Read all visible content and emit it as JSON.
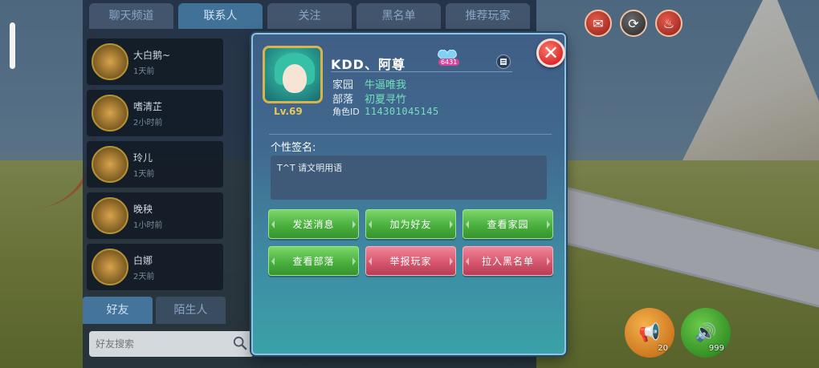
{
  "friends_panel": {
    "tabs": [
      "聊天频道",
      "联系人",
      "关注",
      "黑名单",
      "推荐玩家"
    ],
    "active_tab_index": 1,
    "friends": [
      {
        "name": "大白鹅~",
        "status": "1天前"
      },
      {
        "name": "嗜清芷",
        "status": "2小时前"
      },
      {
        "name": "玲儿",
        "status": "1天前"
      },
      {
        "name": "晚秧",
        "status": "1小时前"
      },
      {
        "name": "白娜",
        "status": "2天前"
      }
    ],
    "bottom_tabs": [
      "好友",
      "陌生人"
    ],
    "search": {
      "placeholder": "好友搜索"
    }
  },
  "profile": {
    "name": "KDD、阿尊",
    "level": "Lv.69",
    "heart_count": "6431",
    "home": {
      "label": "家园",
      "value": "牛逼唯我"
    },
    "tribe": {
      "label": "部落",
      "value": "初夏寻竹"
    },
    "role_id": {
      "label": "角色ID",
      "value": "114301045145"
    },
    "signature_label": "个性签名:",
    "signature_text": "T^T 请文明用语",
    "buttons": {
      "send_message": "发送消息",
      "add_friend": "加为好友",
      "view_home": "查看家园",
      "view_tribe": "查看部落",
      "report_player": "举报玩家",
      "block": "拉入黑名单"
    }
  },
  "hud": {
    "bottom_counts": [
      "20",
      "999"
    ]
  },
  "colors": {
    "dialog_top": "#3f5e86",
    "dialog_bottom": "#3aa2a8",
    "accent_green": "#49b03e",
    "accent_red": "#d7566e",
    "close_red": "#d8262a",
    "value_teal": "#6fe3b8"
  }
}
